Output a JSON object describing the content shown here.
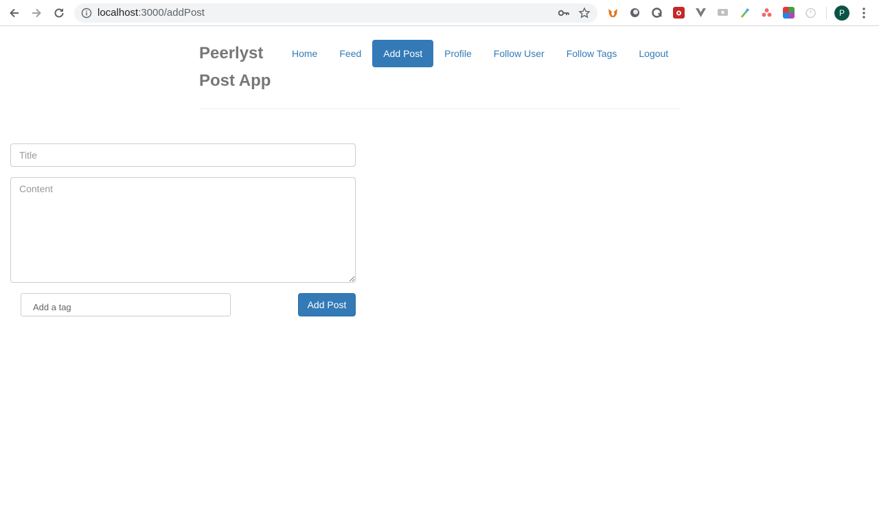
{
  "browser": {
    "url_host": "localhost",
    "url_path": ":3000/addPost",
    "profile_initial": "P"
  },
  "app": {
    "brand": "Peerlyst Post App",
    "nav": [
      {
        "label": "Home"
      },
      {
        "label": "Feed"
      },
      {
        "label": "Add Post"
      },
      {
        "label": "Profile"
      },
      {
        "label": "Follow User"
      },
      {
        "label": "Follow Tags"
      },
      {
        "label": "Logout"
      }
    ],
    "active_nav": "Add Post",
    "accent_color": "#337ab7"
  },
  "form": {
    "title_placeholder": "Title",
    "title_value": "",
    "content_placeholder": "Content",
    "content_value": "",
    "tag_placeholder": "Add a tag",
    "tag_value": "",
    "submit_label": "Add Post"
  }
}
